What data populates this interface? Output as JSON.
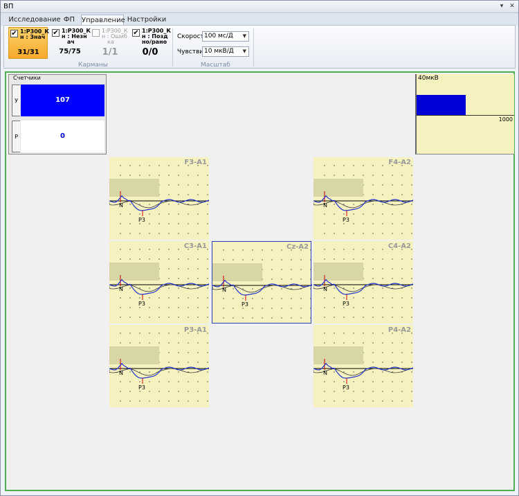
{
  "window": {
    "title": "ВП",
    "pin_icon": "pin-icon",
    "close_icon": "close-icon"
  },
  "tabs": [
    {
      "label": "Исследование",
      "active": false
    },
    {
      "label": "ФП",
      "active": false
    },
    {
      "label": "Управление",
      "active": true
    },
    {
      "label": "Настройки",
      "active": false
    }
  ],
  "ribbon": {
    "pockets": [
      {
        "name": "1:P300_Кн : Знач",
        "value": "31/31",
        "checked": true,
        "enabled": true,
        "selected": true
      },
      {
        "name": "1:P300_Кн : Незначх",
        "value": "75/75",
        "checked": true,
        "enabled": true,
        "selected": false
      },
      {
        "name": "1:P300_Кн : Ошибка",
        "value": "1/1",
        "checked": false,
        "enabled": false,
        "selected": false
      },
      {
        "name": "1:P300_Кн : Поздно/рано",
        "value": "0/0",
        "checked": true,
        "enabled": true,
        "selected": false
      }
    ],
    "pocket_lines": [
      [
        "1:P300_К",
        "н : Знач"
      ],
      [
        "1:P300_К",
        "н : Незн",
        "ач"
      ],
      [
        "1:P300_К",
        "н : Ошиб",
        "ка"
      ],
      [
        "1:P300_К",
        "н : Позд",
        "но/рано"
      ]
    ],
    "pockets_group_label": "Карманы",
    "speed_label": "Скорость",
    "speed_value": "100 мс/Д",
    "sens_label": "Чувствит.",
    "sens_value": "10 мкВ/Д",
    "scale_group_label": "Масштаб"
  },
  "counters": {
    "title": "Счетчики",
    "rows": [
      {
        "label": "У",
        "value": "107",
        "color": "#0000ff"
      },
      {
        "label": "Р",
        "value": "0",
        "color": "#ffffff"
      }
    ]
  },
  "scale": {
    "amplitude_label": "40мкВ",
    "time_label": "1000"
  },
  "panels": [
    {
      "lead": "F3-A1",
      "active": false,
      "peaks": [
        "N",
        "P3"
      ]
    },
    {
      "lead": "F4-A2",
      "active": false,
      "peaks": [
        "N",
        "P3"
      ]
    },
    {
      "lead": "C3-A1",
      "active": false,
      "peaks": [
        "N",
        "P3"
      ]
    },
    {
      "lead": "Cz-A2",
      "active": true,
      "peaks": [
        "N",
        "P3"
      ]
    },
    {
      "lead": "C4-A2",
      "active": false,
      "peaks": [
        "N",
        "P3"
      ]
    },
    {
      "lead": "P3-A1",
      "active": false,
      "peaks": [
        "N",
        "P3"
      ]
    },
    {
      "lead": "P4-A2",
      "active": false,
      "peaks": [
        "N",
        "P3"
      ]
    }
  ],
  "colors": {
    "accent_selected": "#f6a92a",
    "panel_bg": "#f5f2c0",
    "trace_blue": "#2233cc",
    "active_border": "#4caf50"
  }
}
